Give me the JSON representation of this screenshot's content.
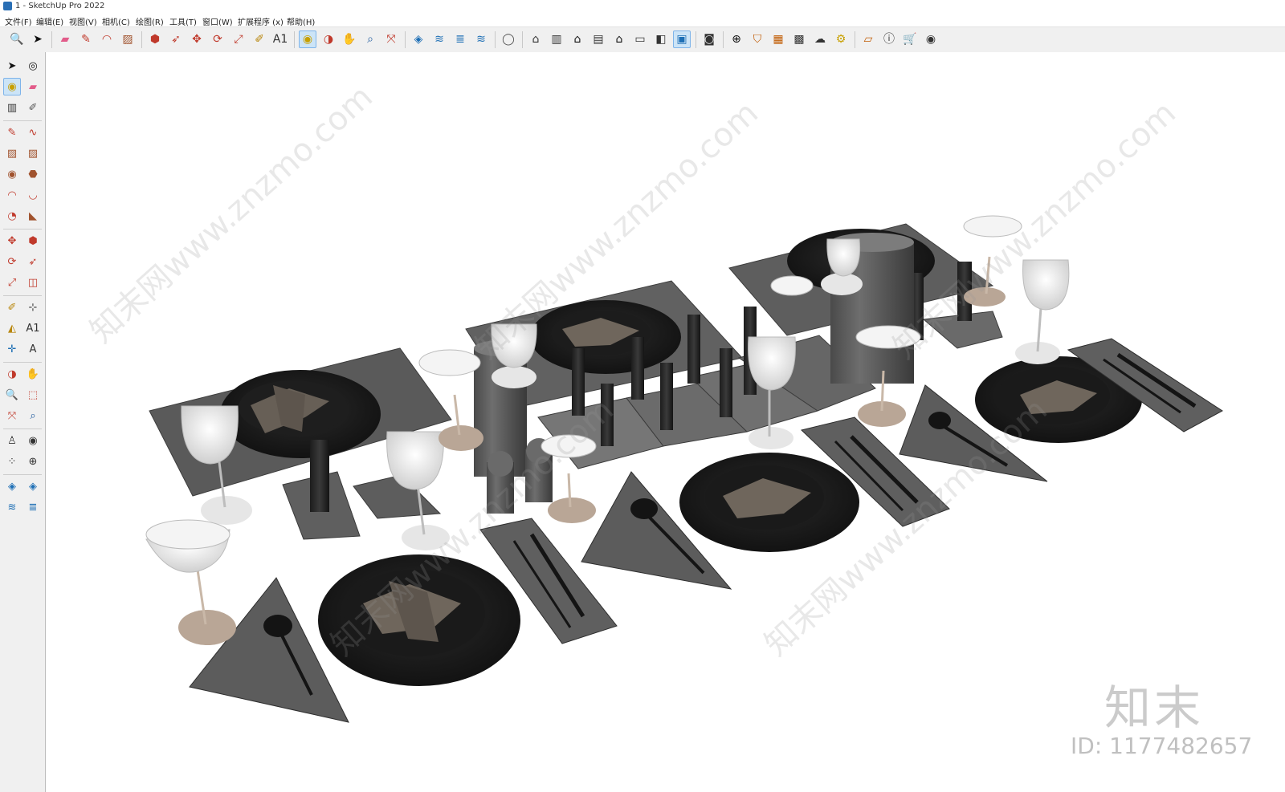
{
  "window": {
    "title": "1 - SketchUp Pro 2022"
  },
  "menu": [
    "文件(F)",
    "编辑(E)",
    "视图(V)",
    "相机(C)",
    "绘图(R)",
    "工具(T)",
    "窗口(W)",
    "扩展程序 (x)",
    "帮助(H)"
  ],
  "toolbar": {
    "icons": [
      "zoom-icon",
      "select-icon",
      "eraser-icon",
      "pencil-line-icon",
      "arc-icon",
      "rectangle-icon",
      "push-pull-icon",
      "follow-me-icon",
      "move-icon",
      "rotate-icon",
      "scale-icon",
      "tape-measure-icon",
      "text-icon",
      "paint-bucket-icon",
      "orbit-icon",
      "pan-icon",
      "zoom-glass-icon",
      "zoom-extents-icon",
      "sandbox-icon",
      "layers-icon",
      "tags-icon",
      "scenes-icon",
      "user-icon",
      "warehouse-icon",
      "component-icon",
      "home-icon",
      "iso-view-icon",
      "front-view-icon",
      "top-view-icon",
      "section-icon",
      "section-fill-icon",
      "camera-icon",
      "add-icon",
      "shield-icon",
      "style-icon",
      "pattern-icon",
      "cloud-icon",
      "settings-icon",
      "extension-icon",
      "info-icon",
      "cart-icon",
      "account-icon"
    ],
    "active": [
      "paint-bucket-icon",
      "section-fill-icon"
    ]
  },
  "lefttools": {
    "icons": [
      "select-arrow-icon",
      "orbit-small-icon",
      "paint-bucket-icon",
      "eraser-icon",
      "component-icon",
      "tape-icon",
      "pencil-icon",
      "freehand-icon",
      "rectangle-icon",
      "rotated-rect-icon",
      "circle-icon",
      "polygon-icon",
      "arc-icon",
      "arc3-icon",
      "pie-icon",
      "sector-icon",
      "move-icon",
      "push-pull-icon",
      "rotate-icon",
      "follow-me-icon",
      "scale-icon",
      "offset-icon",
      "tape-measure-icon",
      "dimension-icon",
      "protractor-icon",
      "text-icon",
      "axes-icon",
      "3d-text-icon",
      "orbit-icon",
      "pan-icon",
      "zoom-icon",
      "zoom-window-icon",
      "zoom-extents-icon",
      "previous-view-icon",
      "position-camera-icon",
      "look-around-icon",
      "walk-icon",
      "section-plane-icon",
      "sandbox-icon",
      "stamp-icon",
      "drape-icon",
      "flip-icon"
    ]
  },
  "watermark": {
    "site": "知末网www.znzmo.com",
    "logo": "知末",
    "id": "ID: 1177482657"
  }
}
